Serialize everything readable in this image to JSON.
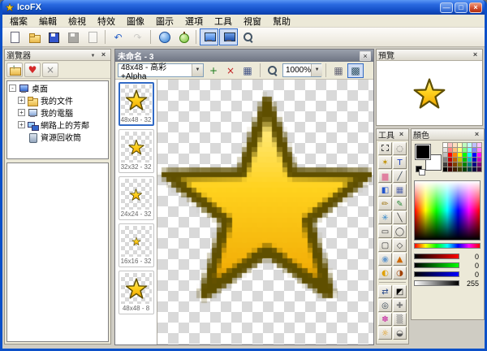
{
  "window": {
    "title": "IcoFX"
  },
  "menu": {
    "items": [
      "檔案",
      "編輯",
      "檢視",
      "特效",
      "圖像",
      "圖示",
      "選項",
      "工具",
      "視窗",
      "幫助"
    ]
  },
  "toolbar": {
    "buttons": [
      {
        "name": "new",
        "icon": "page"
      },
      {
        "name": "open",
        "icon": "folder"
      },
      {
        "name": "save",
        "icon": "disk"
      },
      {
        "name": "save-all",
        "icon": "disk",
        "state": "disabled"
      },
      {
        "name": "export",
        "icon": "page",
        "state": "disabled"
      },
      {
        "sep": true
      },
      {
        "name": "undo",
        "glyph": "↶",
        "color": "#2a62c8"
      },
      {
        "name": "redo",
        "glyph": "↷",
        "color": "#9a9a9a",
        "state": "disabled"
      },
      {
        "sep": true
      },
      {
        "name": "internet",
        "icon": "globe"
      },
      {
        "name": "mac-icon",
        "icon": "apple"
      },
      {
        "sep": true
      },
      {
        "name": "capture",
        "icon": "monitor",
        "state": "pressed"
      },
      {
        "name": "capture-settings",
        "icon": "monitor2",
        "state": "pressed"
      },
      {
        "name": "search",
        "icon": "magnifier"
      }
    ]
  },
  "browser": {
    "title": "瀏覽器",
    "toolbar": [
      {
        "name": "folder-up",
        "icon": "folderup"
      },
      {
        "name": "favorites",
        "glyph": "♥",
        "color": "#d42a2a"
      },
      {
        "name": "delete",
        "glyph": "×",
        "color": "#888888"
      }
    ],
    "tree": [
      {
        "label": "桌面",
        "icon": "desktop",
        "level": 0,
        "exp": "-"
      },
      {
        "label": "我的文件",
        "icon": "folder",
        "level": 1,
        "exp": "+"
      },
      {
        "label": "我的電腦",
        "icon": "computer",
        "level": 1,
        "exp": "+"
      },
      {
        "label": "網路上的芳鄰",
        "icon": "network",
        "level": 1,
        "exp": "+"
      },
      {
        "label": "資源回收筒",
        "icon": "recycle",
        "level": 1,
        "exp": ""
      }
    ]
  },
  "document": {
    "title": "未命名 - 3",
    "format_value": "48x48 - 高彩+Alpha",
    "toolbar_buttons": [
      {
        "name": "add-image",
        "glyph": "+",
        "color": "#1a7a1a"
      },
      {
        "name": "delete-image",
        "glyph": "×",
        "color": "#c22222"
      },
      {
        "name": "image-settings",
        "glyph": "▦",
        "color": "#445588"
      }
    ],
    "zoom_value": "1000%",
    "view_buttons": [
      {
        "name": "grid-toggle",
        "glyph": "▦",
        "color": "#667",
        "state": ""
      },
      {
        "name": "pixel-grid-toggle",
        "glyph": "▩",
        "color": "#356",
        "state": "pressed"
      }
    ],
    "thumbnails": [
      {
        "label": "48x48 - 32",
        "size": 30,
        "selected": true
      },
      {
        "label": "32x32 - 32",
        "size": 22,
        "selected": false
      },
      {
        "label": "24x24 - 32",
        "size": 17,
        "selected": false
      },
      {
        "label": "16x16 - 32",
        "size": 12,
        "selected": false
      },
      {
        "label": "48x48 - 8",
        "size": 30,
        "selected": false
      }
    ]
  },
  "preview": {
    "title": "預覽"
  },
  "tools": {
    "title": "工具",
    "main": [
      {
        "name": "select-rectangle",
        "glyph": "",
        "color": "#444444",
        "special": "selection"
      },
      {
        "name": "select-lasso",
        "glyph": "◌",
        "color": "#555555"
      },
      {
        "name": "magic-wand",
        "glyph": "✶",
        "color": "#c09000"
      },
      {
        "name": "text",
        "glyph": "T",
        "color": "#1a3fbf"
      },
      {
        "name": "eraser",
        "glyph": "▆",
        "color": "#e080a0"
      },
      {
        "name": "color-picker",
        "glyph": "╱",
        "color": "#334455"
      },
      {
        "name": "fill",
        "glyph": "◧",
        "color": "#2255cc"
      },
      {
        "name": "gradient",
        "glyph": "▦",
        "color": "#5566aa"
      },
      {
        "name": "pencil",
        "glyph": "✏",
        "color": "#a07818"
      },
      {
        "name": "brush",
        "glyph": "✎",
        "color": "#2a8a3a"
      },
      {
        "name": "airbrush",
        "glyph": "✳",
        "color": "#3388cc"
      },
      {
        "name": "line",
        "glyph": "╲",
        "color": "#333333"
      },
      {
        "name": "rectangle",
        "glyph": "▭",
        "color": "#333333"
      },
      {
        "name": "ellipse",
        "glyph": "◯",
        "color": "#333333"
      },
      {
        "name": "rounded-rectangle",
        "glyph": "▢",
        "color": "#333333"
      },
      {
        "name": "polygon",
        "glyph": "◇",
        "color": "#333333"
      },
      {
        "name": "blur",
        "glyph": "◉",
        "color": "#6699cc"
      },
      {
        "name": "sharpen",
        "glyph": "▲",
        "color": "#cc6600"
      },
      {
        "name": "dodge",
        "glyph": "◐",
        "color": "#e0a000"
      },
      {
        "name": "burn",
        "glyph": "◑",
        "color": "#a04000"
      }
    ],
    "extra": [
      {
        "name": "swap-colors",
        "glyph": "⇄",
        "color": "#224488"
      },
      {
        "name": "default-colors",
        "glyph": "◩",
        "color": "#000000"
      },
      {
        "name": "zoom",
        "glyph": "◎",
        "color": "#334455"
      },
      {
        "name": "pan",
        "glyph": "✚",
        "color": "#777777"
      },
      {
        "name": "hue",
        "glyph": "✽",
        "color": "#cc44aa"
      },
      {
        "name": "opacity",
        "glyph": "▒",
        "color": "#888888"
      },
      {
        "name": "brightness",
        "glyph": "☼",
        "color": "#e09000"
      },
      {
        "name": "contrast",
        "glyph": "◒",
        "color": "#555555"
      }
    ]
  },
  "colors": {
    "title": "顏色",
    "foreground": "#000000",
    "background": "#ffffff",
    "palette": [
      "#ffffff",
      "#ffc0c0",
      "#ffe0c0",
      "#ffffc0",
      "#c0ffc0",
      "#c0ffff",
      "#c0c0ff",
      "#ffc0ff",
      "#e0e0e0",
      "#ff8080",
      "#ffc080",
      "#ffff80",
      "#80ff80",
      "#80ffff",
      "#8080ff",
      "#ff80ff",
      "#c0c0c0",
      "#ff0000",
      "#ff8000",
      "#ffff00",
      "#00ff00",
      "#00ffff",
      "#0000ff",
      "#ff00ff",
      "#808080",
      "#c00000",
      "#c06000",
      "#c0c000",
      "#00c000",
      "#00c0c0",
      "#0000c0",
      "#c000c0",
      "#404040",
      "#800000",
      "#804000",
      "#808000",
      "#008000",
      "#008080",
      "#000080",
      "#800080",
      "#000000",
      "#400000",
      "#402000",
      "#404000",
      "#004000",
      "#004040",
      "#000040",
      "#400040"
    ],
    "sliders": [
      {
        "name": "red",
        "from": "#000000",
        "to": "#ff0000",
        "value": "0"
      },
      {
        "name": "green",
        "from": "#000000",
        "to": "#00ff00",
        "value": "0"
      },
      {
        "name": "blue",
        "from": "#000000",
        "to": "#0000ff",
        "value": "0"
      },
      {
        "name": "alpha",
        "from": "#ffffff",
        "to": "#000000",
        "value": "255"
      }
    ]
  }
}
